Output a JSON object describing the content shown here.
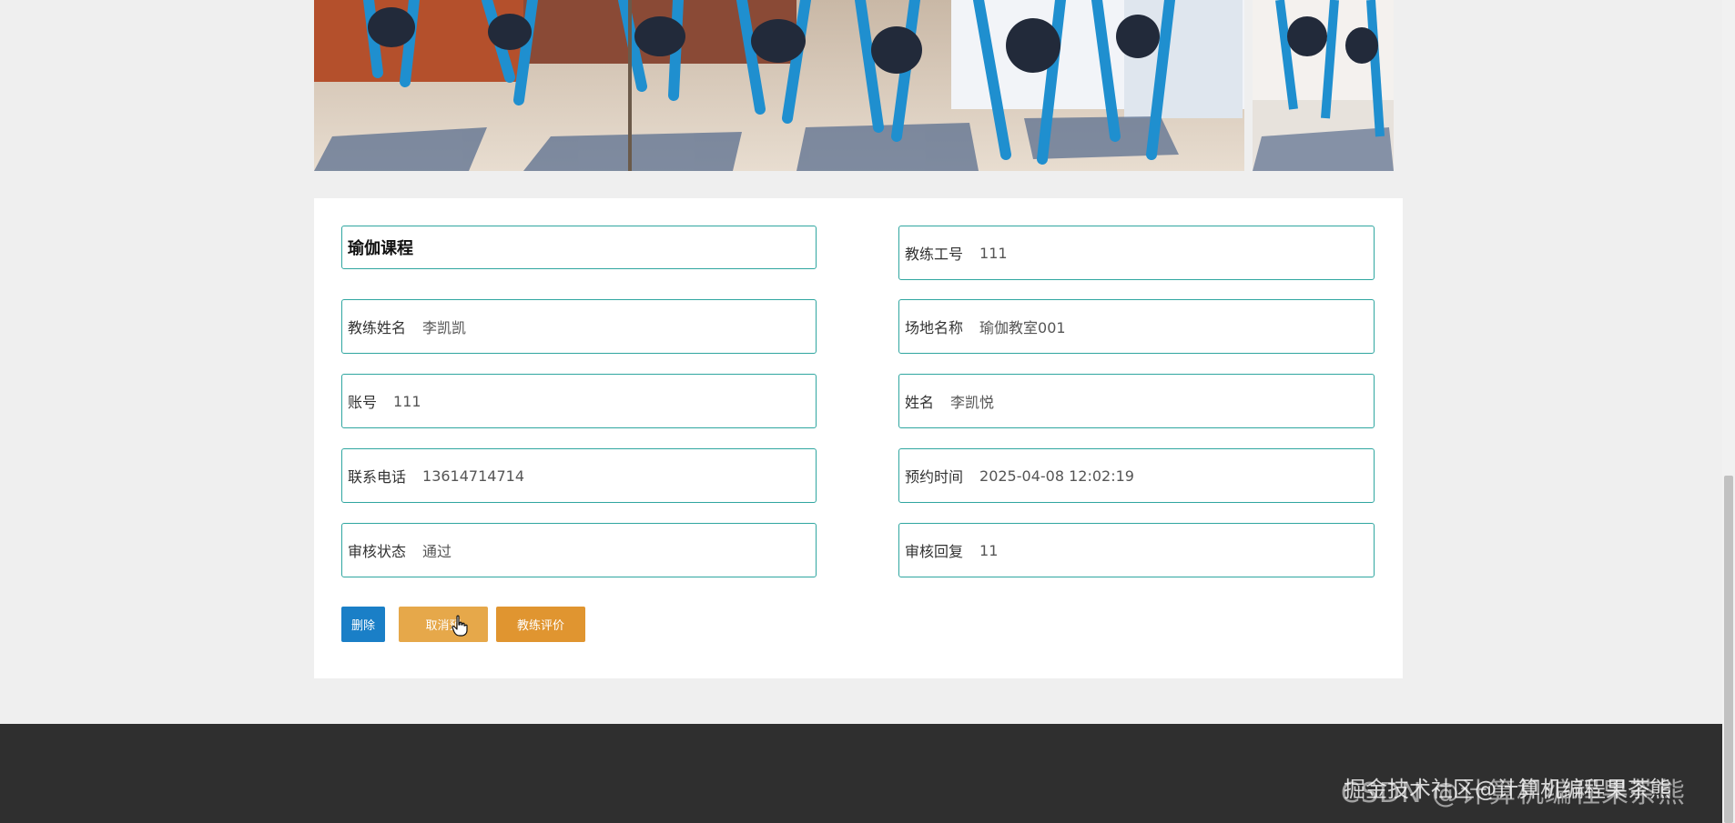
{
  "detail": {
    "title": "瑜伽课程",
    "fields": [
      {
        "label": "教练工号",
        "value": "111"
      },
      {
        "label": "教练姓名",
        "value": "李凯凯"
      },
      {
        "label": "场地名称",
        "value": "瑜伽教室001"
      },
      {
        "label": "账号",
        "value": "111"
      },
      {
        "label": "姓名",
        "value": "李凯悦"
      },
      {
        "label": "联系电话",
        "value": "13614714714"
      },
      {
        "label": "预约时间",
        "value": "2025-04-08 12:02:19"
      },
      {
        "label": "审核状态",
        "value": "通过"
      },
      {
        "label": "审核回复",
        "value": "11"
      }
    ]
  },
  "actions": {
    "delete": "删除",
    "cancel": "取消预",
    "review": "教练评价"
  },
  "footer": {
    "watermark_primary": "CSDN @计算机编程果茶熊",
    "watermark_secondary": "掘金技术社区@计算机编程果茶熊"
  },
  "icons": {
    "cursor": "hand-pointer-icon"
  },
  "colors": {
    "field_border": "#2fa6a0",
    "delete_button": "#1a7fc7",
    "cancel_button": "#e6a84a",
    "review_button": "#e09530",
    "footer": "#2f2f2f"
  }
}
